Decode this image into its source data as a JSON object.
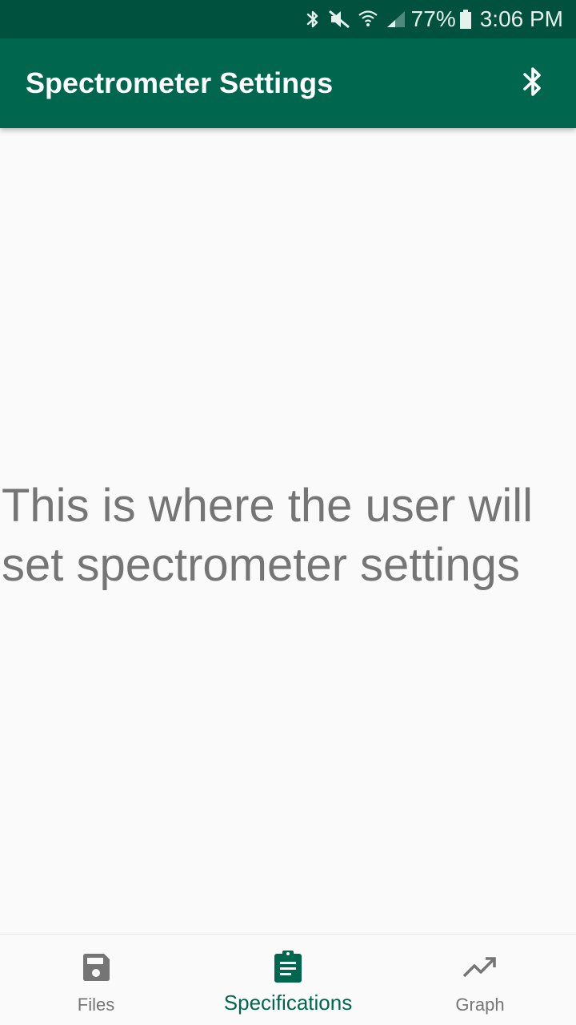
{
  "status_bar": {
    "icons": [
      "bluetooth-icon",
      "mute-icon",
      "wifi-icon",
      "signal-icon",
      "battery-icon"
    ],
    "battery": "77%",
    "time": "3:06 PM"
  },
  "app_bar": {
    "title": "Spectrometer Settings",
    "action_icon": "bluetooth-icon"
  },
  "main": {
    "placeholder": "This is where the user will set spectrometer settings"
  },
  "bottom_nav": {
    "items": [
      {
        "label": "Files",
        "icon": "save-icon",
        "active": false
      },
      {
        "label": "Specifications",
        "icon": "clipboard-icon",
        "active": true
      },
      {
        "label": "Graph",
        "icon": "trending-up-icon",
        "active": false
      }
    ]
  },
  "colors": {
    "status_bar": "#00523f",
    "primary": "#00664d",
    "inactive": "#757575",
    "background": "#fafafa"
  }
}
